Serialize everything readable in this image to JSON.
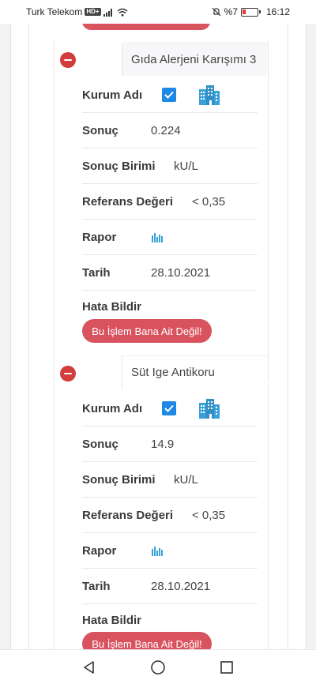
{
  "status_bar": {
    "carrier": "Turk Telekom",
    "hd": "HD+",
    "battery_text": "%7",
    "time": "16:12"
  },
  "sections": [
    {
      "title": "Gıda Alerjeni Karışımı 3",
      "kurum_label": "Kurum Adı",
      "sonuc_label": "Sonuç",
      "sonuc_value": "0.224",
      "birim_label": "Sonuç Birimi",
      "birim_value": "kU/L",
      "referans_label": "Referans Değeri",
      "referans_value": "< 0,35",
      "rapor_label": "Rapor",
      "tarih_label": "Tarih",
      "tarih_value": "28.10.2021",
      "hata_label": "Hata Bildir",
      "button_label": "Bu İşlem Bana Ait Değil!"
    },
    {
      "title": "Süt Ige Antikoru",
      "kurum_label": "Kurum Adı",
      "sonuc_label": "Sonuç",
      "sonuc_value": "14.9",
      "birim_label": "Sonuç Birimi",
      "birim_value": "kU/L",
      "referans_label": "Referans Değeri",
      "referans_value": "< 0,35",
      "rapor_label": "Rapor",
      "tarih_label": "Tarih",
      "tarih_value": "28.10.2021",
      "hata_label": "Hata Bildir",
      "button_label": "Bu İşlem Bana Ait Değil!"
    }
  ],
  "colors": {
    "accent_red": "#d9535f",
    "remove_red": "#d23c3c",
    "checkbox_blue": "#1e88e5",
    "icon_blue": "#3aa0d9"
  }
}
